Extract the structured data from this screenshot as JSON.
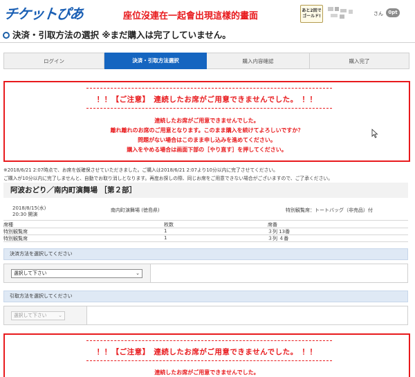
{
  "header": {
    "logo": "チケットぴあ",
    "annotation": "座位沒連在一起會出現這樣的畫面",
    "gold_button": [
      "あと2回で",
      "ゴールド!"
    ],
    "user_suffix": "さん",
    "points_badge": "0pt"
  },
  "page_title": "決済・引取方法の選択 ※まだ購入は完了していません。",
  "steps": [
    "ログイン",
    "決済・引取方法選択",
    "購入内容確認",
    "購入完了"
  ],
  "warning": {
    "heading": "！！【ご注意】　連続したお席がご用意できませんでした。　！！",
    "lines": [
      "連続したお席がご用意できませんでした。",
      "離れ離れのお席のご用意となります。このまま購入を続けてよろしいですか？",
      "問題がない場合はこのまま申し込みを進めてください。",
      "購入をやめる場合は画面下部の［やり直す］を押してください。"
    ]
  },
  "notices": [
    "※2018/6/21 2:07時点で、お席を仮確保させていただきました。ご購入は2018/6/21 2:07より10分以内に完了させてください。",
    "ご購入が10分以内に完了しませんと、自動でお取り消しとなります。再度お探しの際、同じお席をご用意できない場合がございますので、ご了承ください。"
  ],
  "event": {
    "title": "阿波おどり／南内町演舞場 ［第２部］",
    "date": "2018/8/15(水)",
    "time": "20:30 開演",
    "venue": "南内町演舞場 (徳島県)",
    "benefit": "特別観覧席：トートバッグ（非売品）付"
  },
  "seat_table": {
    "headers": [
      "席種",
      "枚数",
      "席番"
    ],
    "rows": [
      [
        "特別観覧席",
        "1",
        "３列 13番"
      ],
      [
        "特別観覧席",
        "1",
        "３列 ４番"
      ]
    ]
  },
  "payment": {
    "section_label": "決済方法を選択してください",
    "select_value": "選択して下さい"
  },
  "pickup": {
    "section_label": "引取方法を選択してください",
    "select_value": "選択して下さい"
  },
  "colors": {
    "accent_blue": "#1565c0",
    "warning_red": "#e8191c",
    "section_bg": "#dfe9f5"
  }
}
